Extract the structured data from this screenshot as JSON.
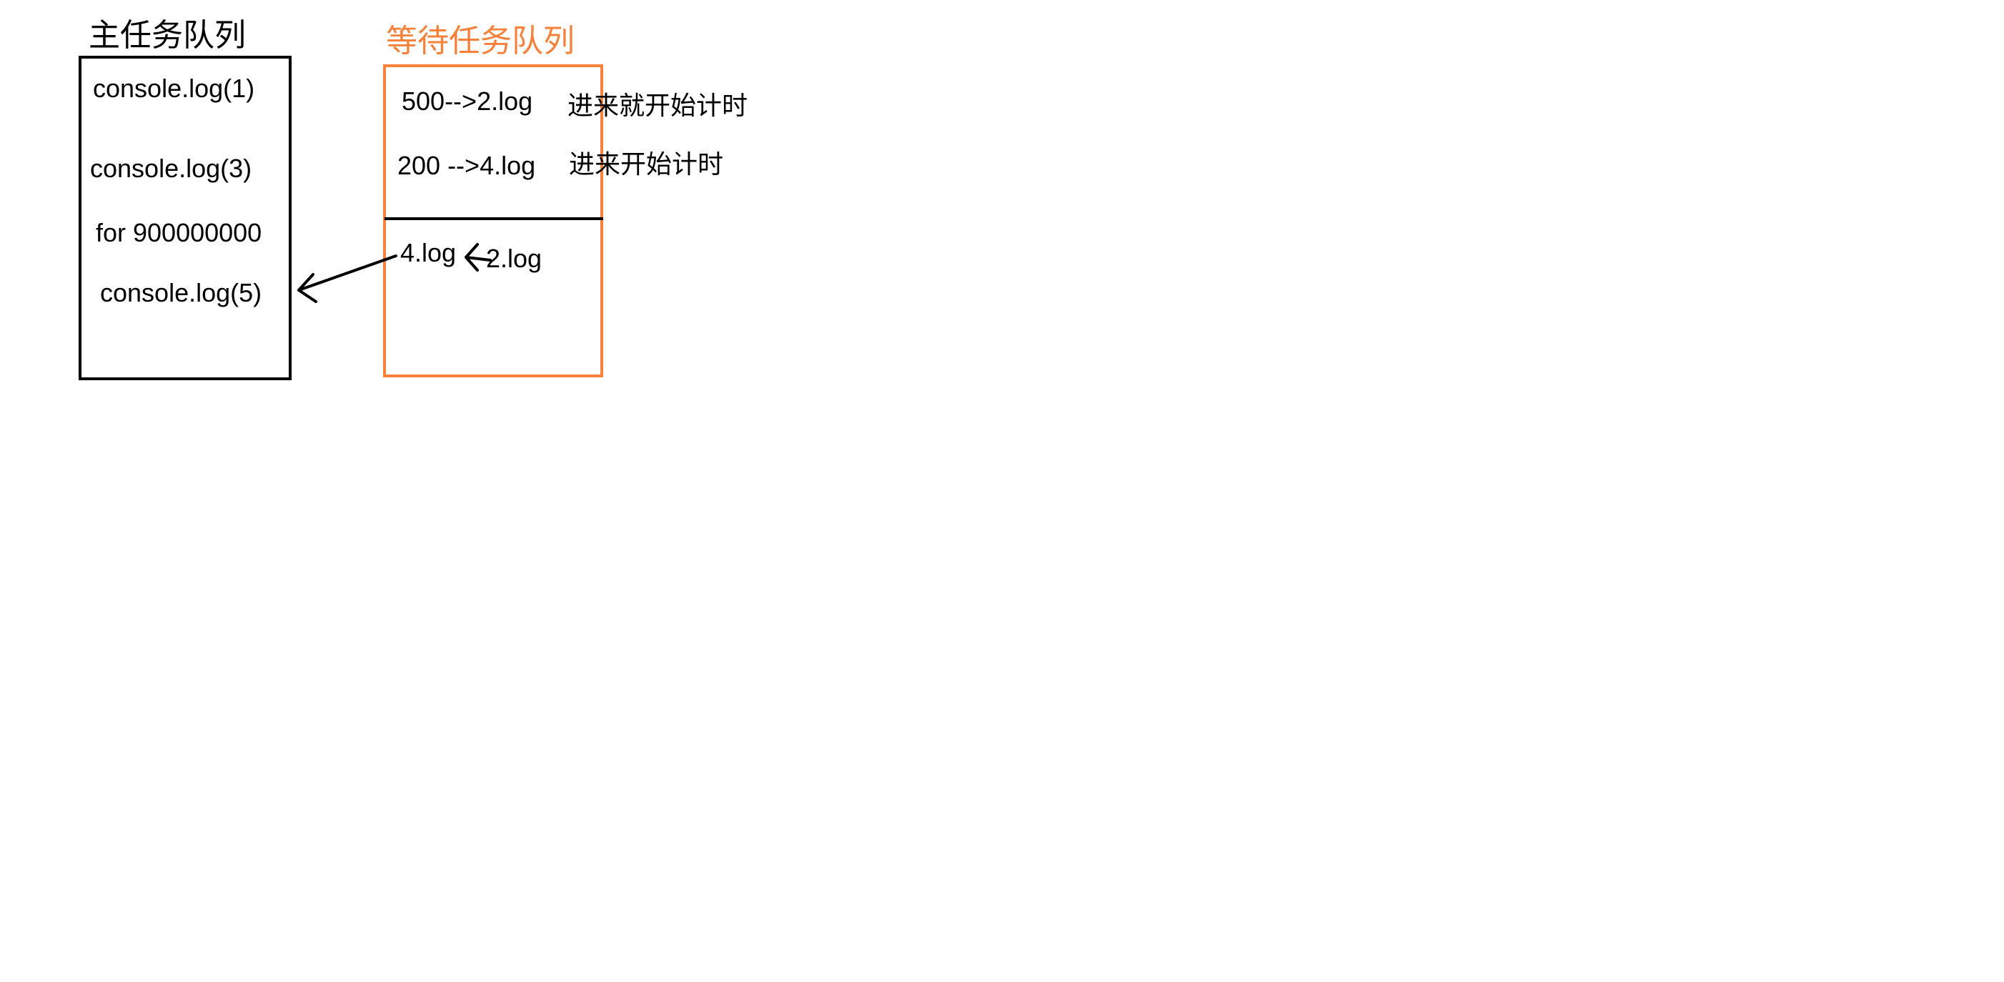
{
  "main_queue": {
    "title": "主任务队列",
    "items": [
      "console.log(1)",
      "console.log(3)",
      "for 900000000",
      "console.log(5)"
    ]
  },
  "wait_queue": {
    "title": "等待任务队列",
    "timers": [
      {
        "text": "500-->2.log",
        "note": "进来就开始计时"
      },
      {
        "text": "200 -->4.log",
        "note": "进来开始计时"
      }
    ],
    "ready": [
      "4.log",
      "2.log"
    ]
  },
  "colors": {
    "main_box": "#000000",
    "wait_box": "#f5813a",
    "wait_title": "#f5813a",
    "arrow": "#000000"
  }
}
